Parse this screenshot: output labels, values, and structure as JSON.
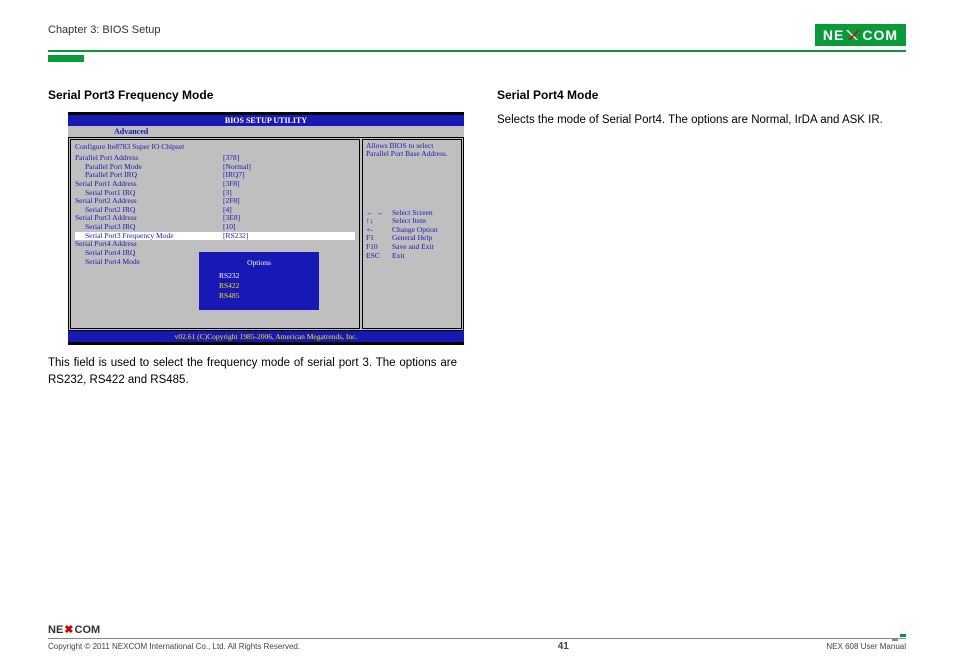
{
  "header": {
    "chapter": "Chapter 3: BIOS Setup",
    "logo_left": "NE",
    "logo_right": "COM"
  },
  "left": {
    "title": "Serial Port3 Frequency Mode",
    "body": "This field is used to select the frequency mode of serial port 3. The options are RS232, RS422 and RS485."
  },
  "right": {
    "title": "Serial Port4 Mode",
    "body": "Selects the mode of Serial Port4. The options are Normal, IrDA and ASK IR."
  },
  "bios": {
    "header": "BIOS SETUP UTILITY",
    "tab": "Advanced",
    "subtitle": "Configure Ite8783 Super IO Chipset",
    "help": "Allows BIOS to select Parallel Port Base Address.",
    "rows": [
      {
        "label": "Parallel Port Address",
        "value": "[378]",
        "indent": 0
      },
      {
        "label": "Parallel Port Mode",
        "value": "[Normal]",
        "indent": 1
      },
      {
        "label": "Parallel Port IRQ",
        "value": "[IRQ7]",
        "indent": 1
      },
      {
        "label": "Serial Port1 Address",
        "value": "[3F8]",
        "indent": 0
      },
      {
        "label": "Serial Port1 IRQ",
        "value": "[3]",
        "indent": 1
      },
      {
        "label": "Serial Port2 Address",
        "value": "[2F8]",
        "indent": 0
      },
      {
        "label": "Serial Port2 IRQ",
        "value": "[4]",
        "indent": 1
      },
      {
        "label": "Serial Port3 Address",
        "value": "[3E8]",
        "indent": 0
      },
      {
        "label": "Serial Port3 IRQ",
        "value": "[10]",
        "indent": 1
      },
      {
        "label": "Serial Port3 Frequency Mode",
        "value": "[RS232]",
        "indent": 1,
        "selected": true
      },
      {
        "label": "Serial Port4 Address",
        "value": "",
        "indent": 0
      },
      {
        "label": "Serial Port4 IRQ",
        "value": "",
        "indent": 1
      },
      {
        "label": "Serial Port4 Mode",
        "value": "",
        "indent": 1
      }
    ],
    "popup": {
      "title": "Options",
      "options": [
        "RS232",
        "RS422",
        "RS485"
      ],
      "selected": "RS232"
    },
    "keys": [
      {
        "k": "← →",
        "d": "Select Screen"
      },
      {
        "k": "↑↓",
        "d": "Select Item"
      },
      {
        "k": "+-",
        "d": "Change Option"
      },
      {
        "k": "F1",
        "d": "General Help"
      },
      {
        "k": "F10",
        "d": "Save and Exit"
      },
      {
        "k": "ESC",
        "d": "Exit"
      }
    ],
    "footer": "v02.61 (C)Copyright 1985-2006, American Megatrends, Inc."
  },
  "footer": {
    "logo1": "NE",
    "logo2": "COM",
    "copyright": "Copyright © 2011 NEXCOM International Co., Ltd. All Rights Reserved.",
    "page": "41",
    "doc": "NEX 608 User Manual"
  }
}
